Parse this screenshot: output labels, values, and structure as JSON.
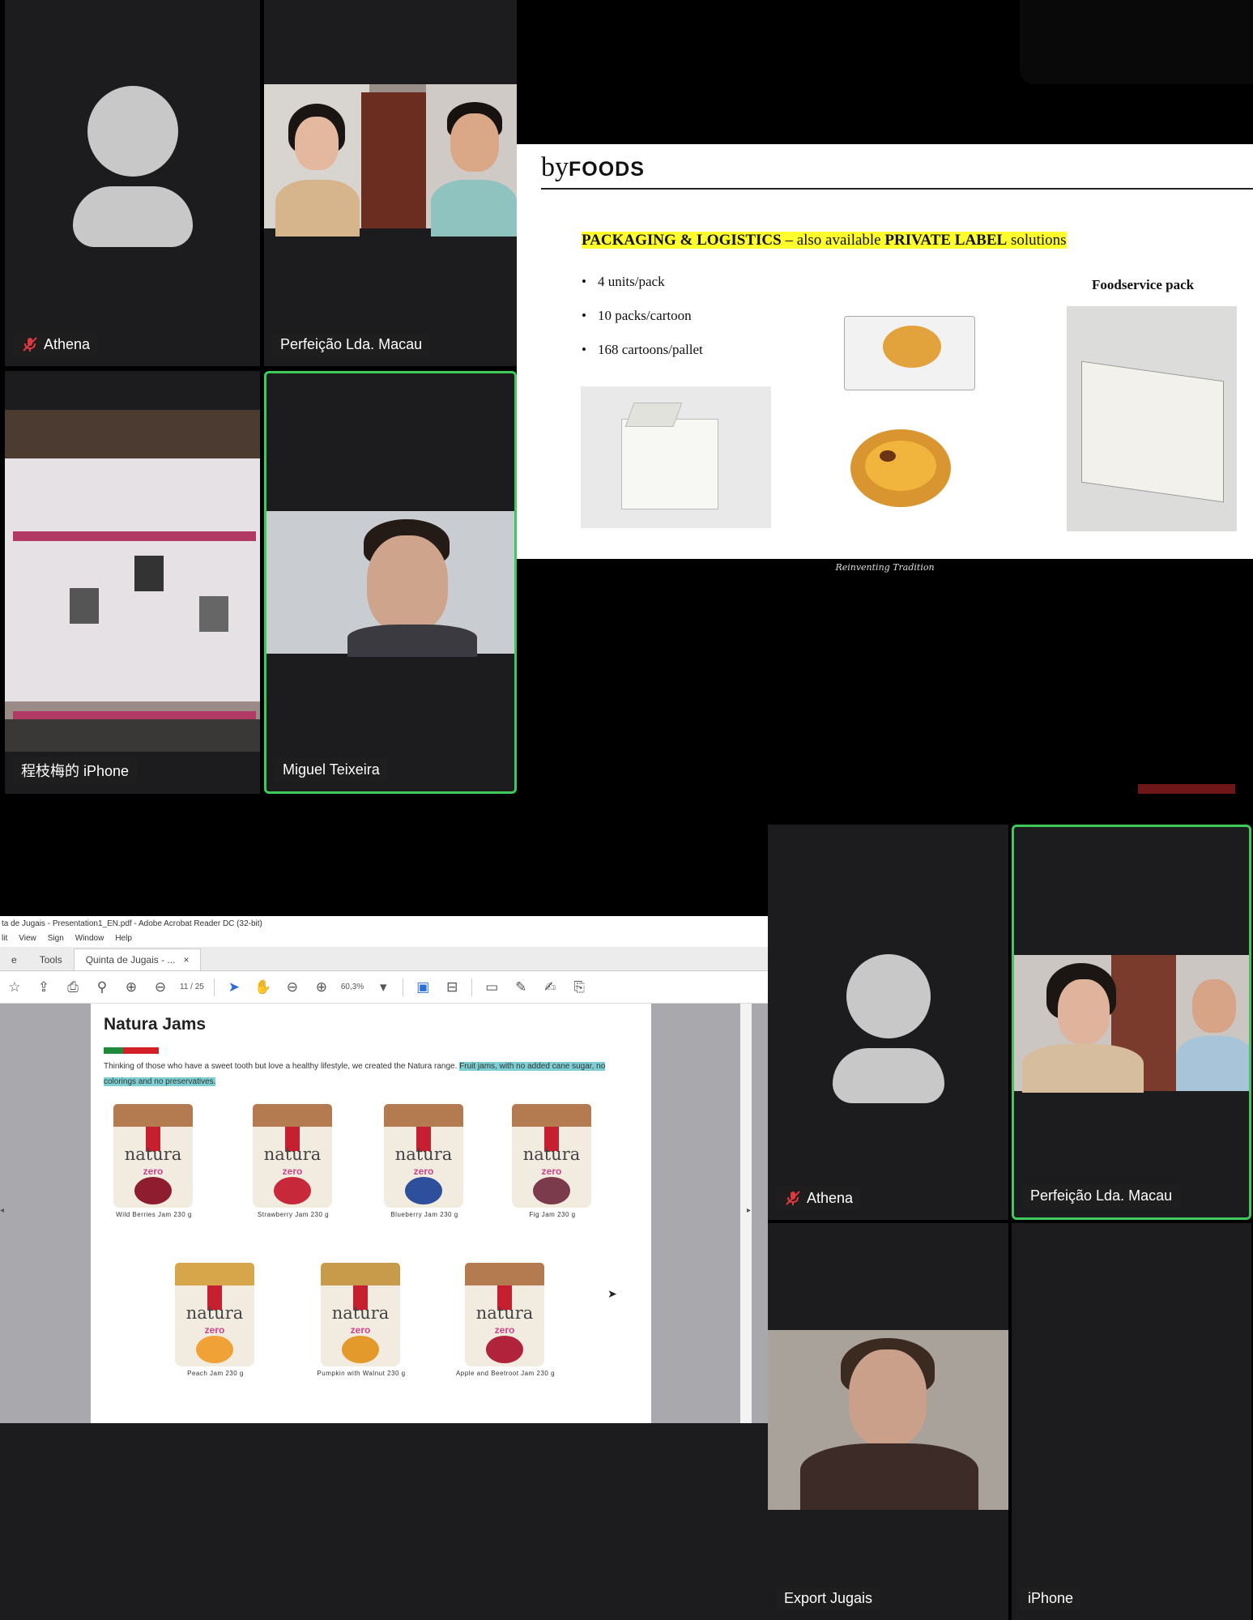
{
  "participants": {
    "top_athena": {
      "name": "Athena",
      "muted": true
    },
    "top_perfeicao": {
      "name": "Perfeição Lda. Macau"
    },
    "top_iphone": {
      "name": "程枝梅的 iPhone"
    },
    "top_miguel": {
      "name": "Miguel Teixeira",
      "active_speaker": true
    },
    "bottom_athena": {
      "name": "Athena",
      "muted": true
    },
    "bottom_perfeicao": {
      "name": "Perfeição Lda. Macau",
      "active_speaker": true
    },
    "bottom_export": {
      "name": "Export Jugais"
    },
    "bottom_iphone": {
      "name": "iPhone"
    }
  },
  "slide": {
    "logo_by": "by",
    "logo_foods": "FOODS",
    "headline_part1": "PACKAGING & LOGISTICS",
    "headline_part2": " – also available ",
    "headline_part3": "PRIVATE LABEL",
    "headline_part4": " solutions",
    "bullets": [
      "4 units/pack",
      "10 packs/cartoon",
      "168 cartoons/pallet"
    ],
    "foodservice_label": "Foodservice pack",
    "footer": "Reinventing Tradition"
  },
  "acrobat": {
    "window_title": "ta de Jugais - Presentation1_EN.pdf - Adobe Acrobat Reader DC (32-bit)",
    "menu": [
      "lit",
      "View",
      "Sign",
      "Window",
      "Help"
    ],
    "tab_home": "e",
    "tab_tools": "Tools",
    "tab_doc": "Quinta de Jugais - ...",
    "tab_close": "×",
    "page_current": "11",
    "page_total": "/ 25",
    "zoom": "60,3%",
    "pdf": {
      "title": "Natura Jams",
      "desc_plain": "Thinking of those who have a sweet tooth but love a healthy lifestyle, we created the Natura range. ",
      "desc_highlight": "Fruit jams, with no added cane sugar, no colorings and no preservatives.",
      "jar_brand": "natura",
      "jar_sub": "zero",
      "captions": [
        "Wild Berries Jam 230 g",
        "Strawberry Jam 230 g",
        "Blueberry Jam 230 g",
        "Fig Jam 230 g",
        "Peach Jam 230 g",
        "Pumpkin with Walnut 230 g",
        "Apple and Beetroot Jam 230 g"
      ]
    }
  },
  "colors": {
    "active_border": "#3ec95a",
    "highlight_yellow": "#ffff2e",
    "highlight_teal": "#7ecfd4",
    "muted_red": "#e0383e"
  }
}
